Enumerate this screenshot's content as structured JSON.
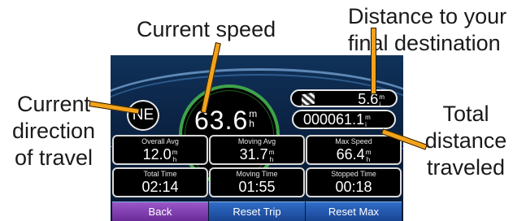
{
  "callouts": {
    "current_speed": "Current speed",
    "distance_line1": "Distance to your",
    "distance_line2": "final destination",
    "direction_line1": "Current",
    "direction_line2": "direction",
    "direction_line3": "of travel",
    "total_line1": "Total",
    "total_line2": "distance",
    "total_line3": "traveled"
  },
  "device": {
    "direction": "NE",
    "speed": {
      "value": "63.6",
      "unit_top": "m",
      "unit_bottom": "h"
    },
    "destination_distance": {
      "value": "5.6",
      "unit_top": "m",
      "unit_bottom": "i"
    },
    "odometer": {
      "value": "000061.1",
      "unit_top": "m",
      "unit_bottom": "i"
    },
    "stats": [
      {
        "label": "Overall Avg",
        "value": "12.0",
        "unit_top": "m",
        "unit_bottom": "h"
      },
      {
        "label": "Moving Avg",
        "value": "31.7",
        "unit_top": "m",
        "unit_bottom": "h"
      },
      {
        "label": "Max Speed",
        "value": "66.4",
        "unit_top": "m",
        "unit_bottom": "h"
      },
      {
        "label": "Total Time",
        "value": "02:14"
      },
      {
        "label": "Moving Time",
        "value": "01:55"
      },
      {
        "label": "Stopped Time",
        "value": "00:18"
      }
    ],
    "buttons": {
      "back": "Back",
      "reset_trip": "Reset Trip",
      "reset_max": "Reset Max"
    }
  },
  "colors": {
    "leader_line": "#f2a31b",
    "speed_ring": "#3ea24a",
    "back_button": "#8a48b8",
    "reset_buttons": "#2458b0",
    "screen_background": "#0b2344"
  }
}
